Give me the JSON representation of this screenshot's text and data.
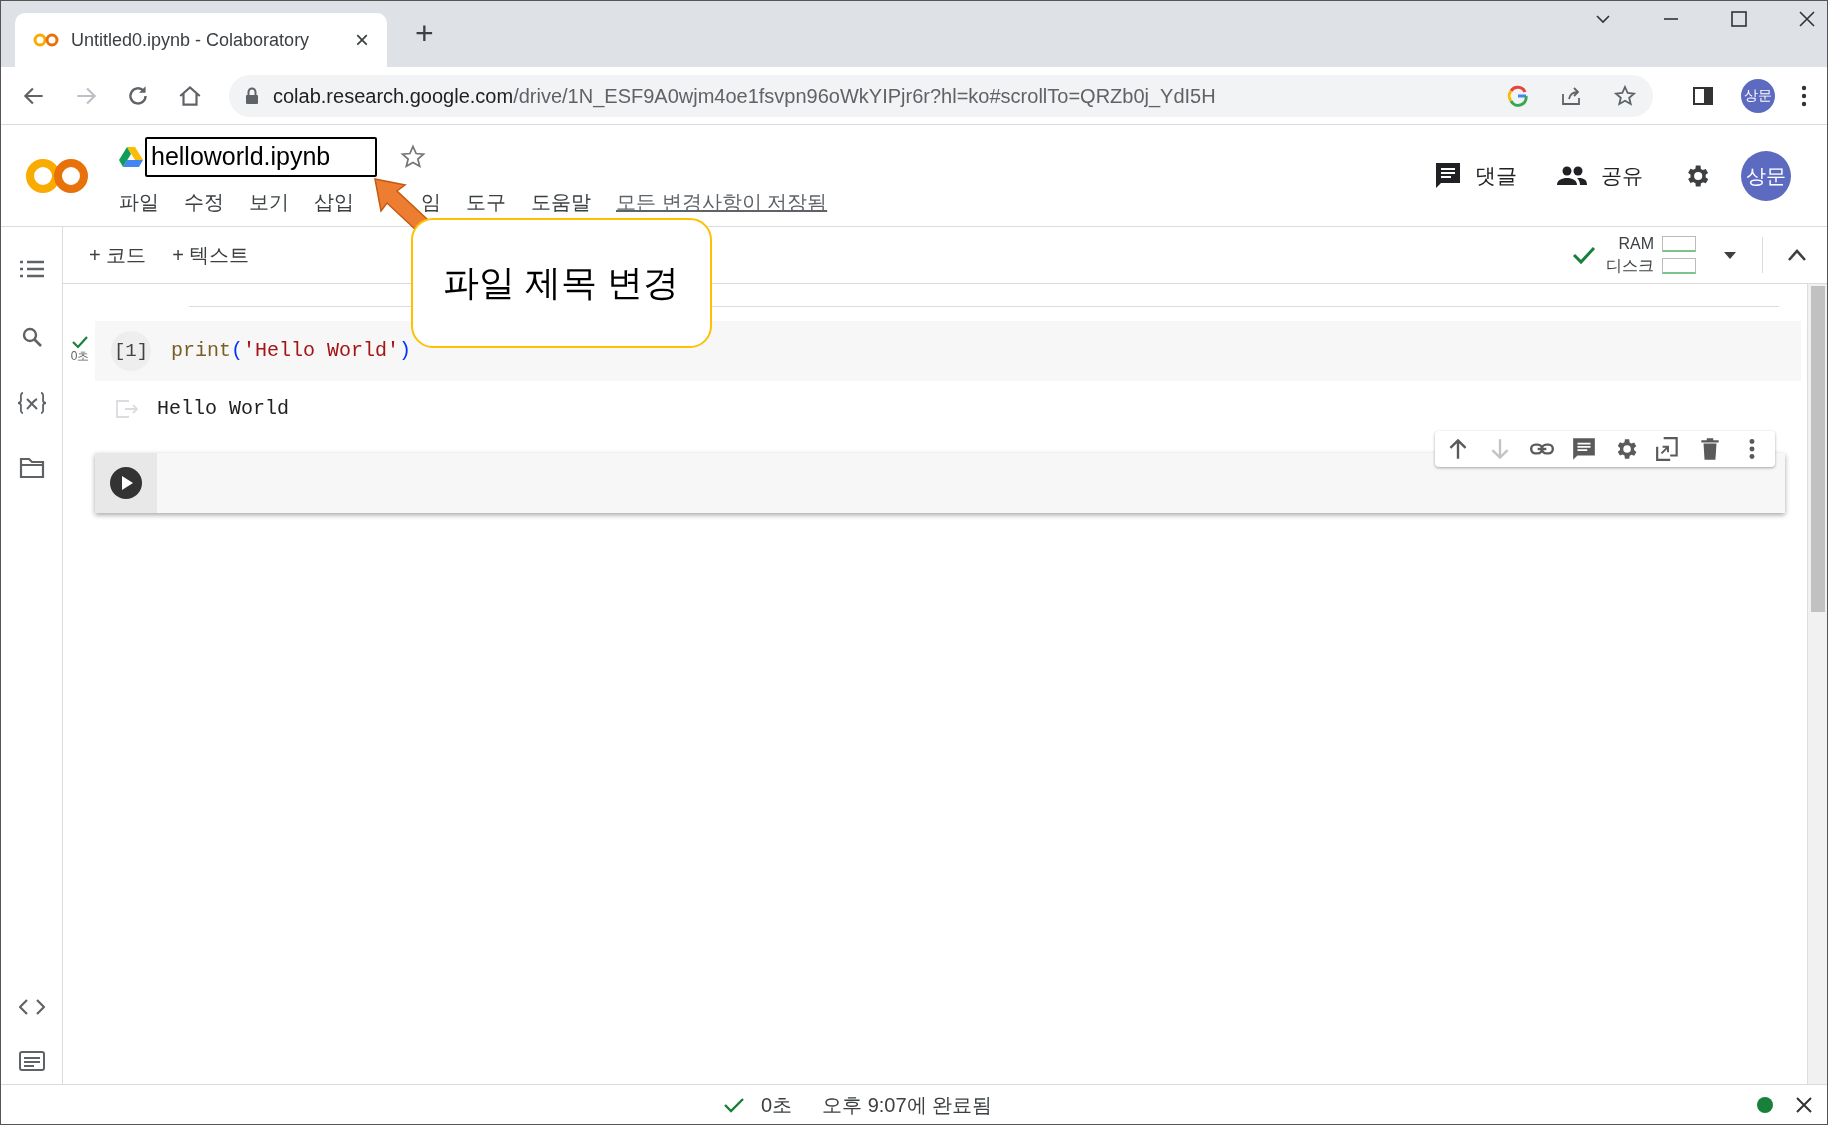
{
  "browser": {
    "tab": {
      "title": "Untitled0.ipynb - Colaboratory",
      "close": "×"
    },
    "new_tab": "+",
    "url": "colab.research.google.com/drive/1N_ESF9A0wjm4oe1fsvpn96oWkYIPjr6r?hl=ko#scrollTo=QRZb0j_YdI5H",
    "profile": "상문"
  },
  "header": {
    "title_field": {
      "value": "helloworld.ipynb"
    },
    "starred": false,
    "menu": [
      {
        "label": "파일"
      },
      {
        "label": "수정"
      },
      {
        "label": "보기"
      },
      {
        "label": "삽입"
      },
      {
        "label": "임"
      },
      {
        "label": "도구"
      },
      {
        "label": "도움말"
      }
    ],
    "save_status": "모든 변경사항이 저장됨",
    "actions": [
      {
        "kind": "comment",
        "label": "댓글"
      },
      {
        "kind": "share",
        "label": "공유"
      }
    ],
    "avatar": "상문"
  },
  "toolbar": {
    "buttons": [
      {
        "label": "+ 코드"
      },
      {
        "label": "+ 텍스트"
      }
    ],
    "resources": {
      "ram": "RAM",
      "disk": "디스크"
    }
  },
  "callout": {
    "text": "파일 제목 변경"
  },
  "cells": [
    {
      "kind": "code",
      "count": "[1]",
      "time": "0초",
      "code": [
        {
          "kind": "fn",
          "text": "print"
        },
        {
          "kind": "paren",
          "text": "("
        },
        {
          "kind": "string",
          "text": "'Hello World'"
        },
        {
          "kind": "paren",
          "text": ")"
        }
      ],
      "output": "Hello World"
    },
    {
      "kind": "empty",
      "toolbar": [
        {
          "kind": "up",
          "disabled": false
        },
        {
          "kind": "down",
          "disabled": true
        },
        {
          "kind": "link",
          "disabled": false
        },
        {
          "kind": "comment",
          "disabled": false
        },
        {
          "kind": "settings",
          "disabled": false
        },
        {
          "kind": "mirror",
          "disabled": false
        },
        {
          "kind": "delete",
          "disabled": false
        },
        {
          "kind": "more",
          "disabled": false
        }
      ]
    }
  ],
  "status_bar": {
    "duration": "0초",
    "completed": "오후 9:07에 완료됨"
  }
}
